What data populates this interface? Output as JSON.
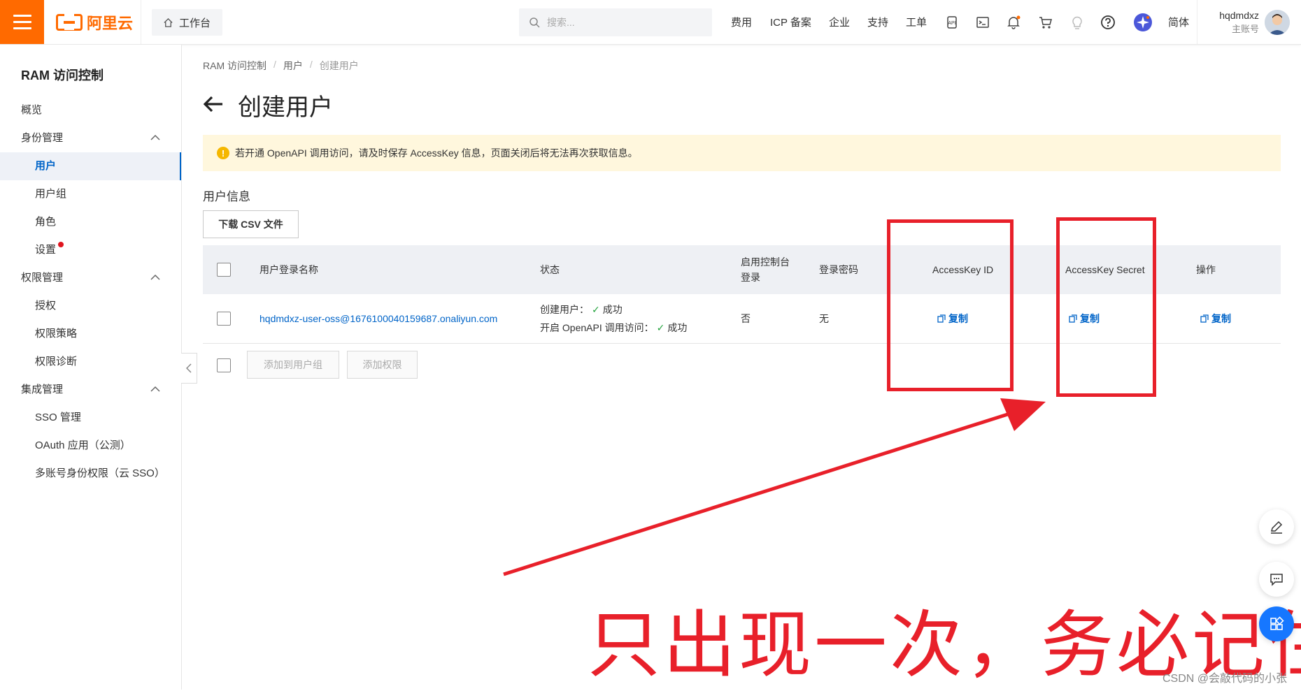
{
  "topbar": {
    "logo_text": "阿里云",
    "workbench_label": "工作台",
    "search_placeholder": "搜索...",
    "nav": [
      "费用",
      "ICP 备案",
      "企业",
      "支持",
      "工单"
    ],
    "lang_label": "简体",
    "user_name": "hqdmdxz",
    "user_role": "主账号",
    "icons": [
      "api-icon",
      "terminal-icon",
      "bell-icon",
      "cart-icon",
      "bulb-icon",
      "help-icon",
      "assistant-icon"
    ]
  },
  "sidebar": {
    "title": "RAM 访问控制",
    "items": [
      {
        "label": "概览"
      },
      {
        "label": "身份管理"
      },
      {
        "label": "用户"
      },
      {
        "label": "用户组"
      },
      {
        "label": "角色"
      },
      {
        "label": "设置"
      },
      {
        "label": "权限管理"
      },
      {
        "label": "授权"
      },
      {
        "label": "权限策略"
      },
      {
        "label": "权限诊断"
      },
      {
        "label": "集成管理"
      },
      {
        "label": "SSO 管理"
      },
      {
        "label": "OAuth 应用（公测）"
      },
      {
        "label": "多账号身份权限（云 SSO）"
      }
    ]
  },
  "breadcrumb": [
    "RAM 访问控制",
    "用户",
    "创建用户"
  ],
  "page_title": "创建用户",
  "alert_text": "若开通 OpenAPI 调用访问，请及时保存 AccessKey 信息，页面关闭后将无法再次获取信息。",
  "section_title": "用户信息",
  "download_csv_label": "下载 CSV 文件",
  "table": {
    "headers": {
      "login_name": "用户登录名称",
      "status": "状态",
      "console_login": "启用控制台登录",
      "password": "登录密码",
      "ak_id": "AccessKey ID",
      "ak_secret": "AccessKey Secret",
      "ops": "操作"
    },
    "row": {
      "login_name": "hqdmdxz-user-oss@1676100040159687.onaliyun.com",
      "status_line1_label": "创建用户：",
      "status_line1_value": "成功",
      "status_line2_label": "开启 OpenAPI 调用访问：",
      "status_line2_value": "成功",
      "console_login": "否",
      "password": "无",
      "copy_label": "复制"
    }
  },
  "bulk_actions": {
    "add_to_group": "添加到用户组",
    "add_permission": "添加权限"
  },
  "annotation": {
    "text": "只出现一次，务必记住",
    "color": "#e8202a"
  },
  "watermark": "CSDN @会敲代码的小张",
  "colors": {
    "brand": "#ff6a00",
    "link": "#0064c8",
    "success": "#22a33c",
    "alert_bg": "#fff7dd"
  }
}
